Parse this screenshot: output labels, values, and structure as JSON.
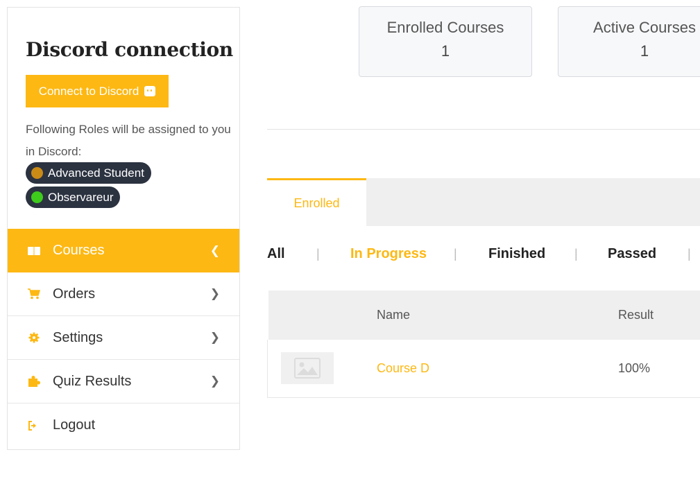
{
  "sidebar": {
    "discord_title": "Discord connection",
    "connect_button": "Connect to Discord",
    "roles_text": "Following Roles will be assigned to you in Discord:",
    "roles": [
      {
        "label": "Advanced Student",
        "color": "#c98a16"
      },
      {
        "label": "Observareur",
        "color": "#3ecb1c"
      }
    ],
    "nav": [
      {
        "label": "Courses",
        "icon": "book-icon",
        "active": true
      },
      {
        "label": "Orders",
        "icon": "cart-icon"
      },
      {
        "label": "Settings",
        "icon": "gear-icon"
      },
      {
        "label": "Quiz Results",
        "icon": "puzzle-icon"
      },
      {
        "label": "Logout",
        "icon": "logout-icon"
      }
    ]
  },
  "stats": [
    {
      "title": "Enrolled Courses",
      "value": "1"
    },
    {
      "title": "Active Courses",
      "value": "1"
    }
  ],
  "tabs": {
    "enrolled": "Enrolled"
  },
  "filters": [
    "All",
    "In Progress",
    "Finished",
    "Passed"
  ],
  "table": {
    "headers": {
      "name": "Name",
      "result": "Result"
    },
    "rows": [
      {
        "name": "Course D",
        "result": "100%",
        "thumbnail": "image-placeholder-icon"
      }
    ]
  },
  "colors": {
    "accent": "#fdb813",
    "pill_bg": "#2b3240"
  }
}
